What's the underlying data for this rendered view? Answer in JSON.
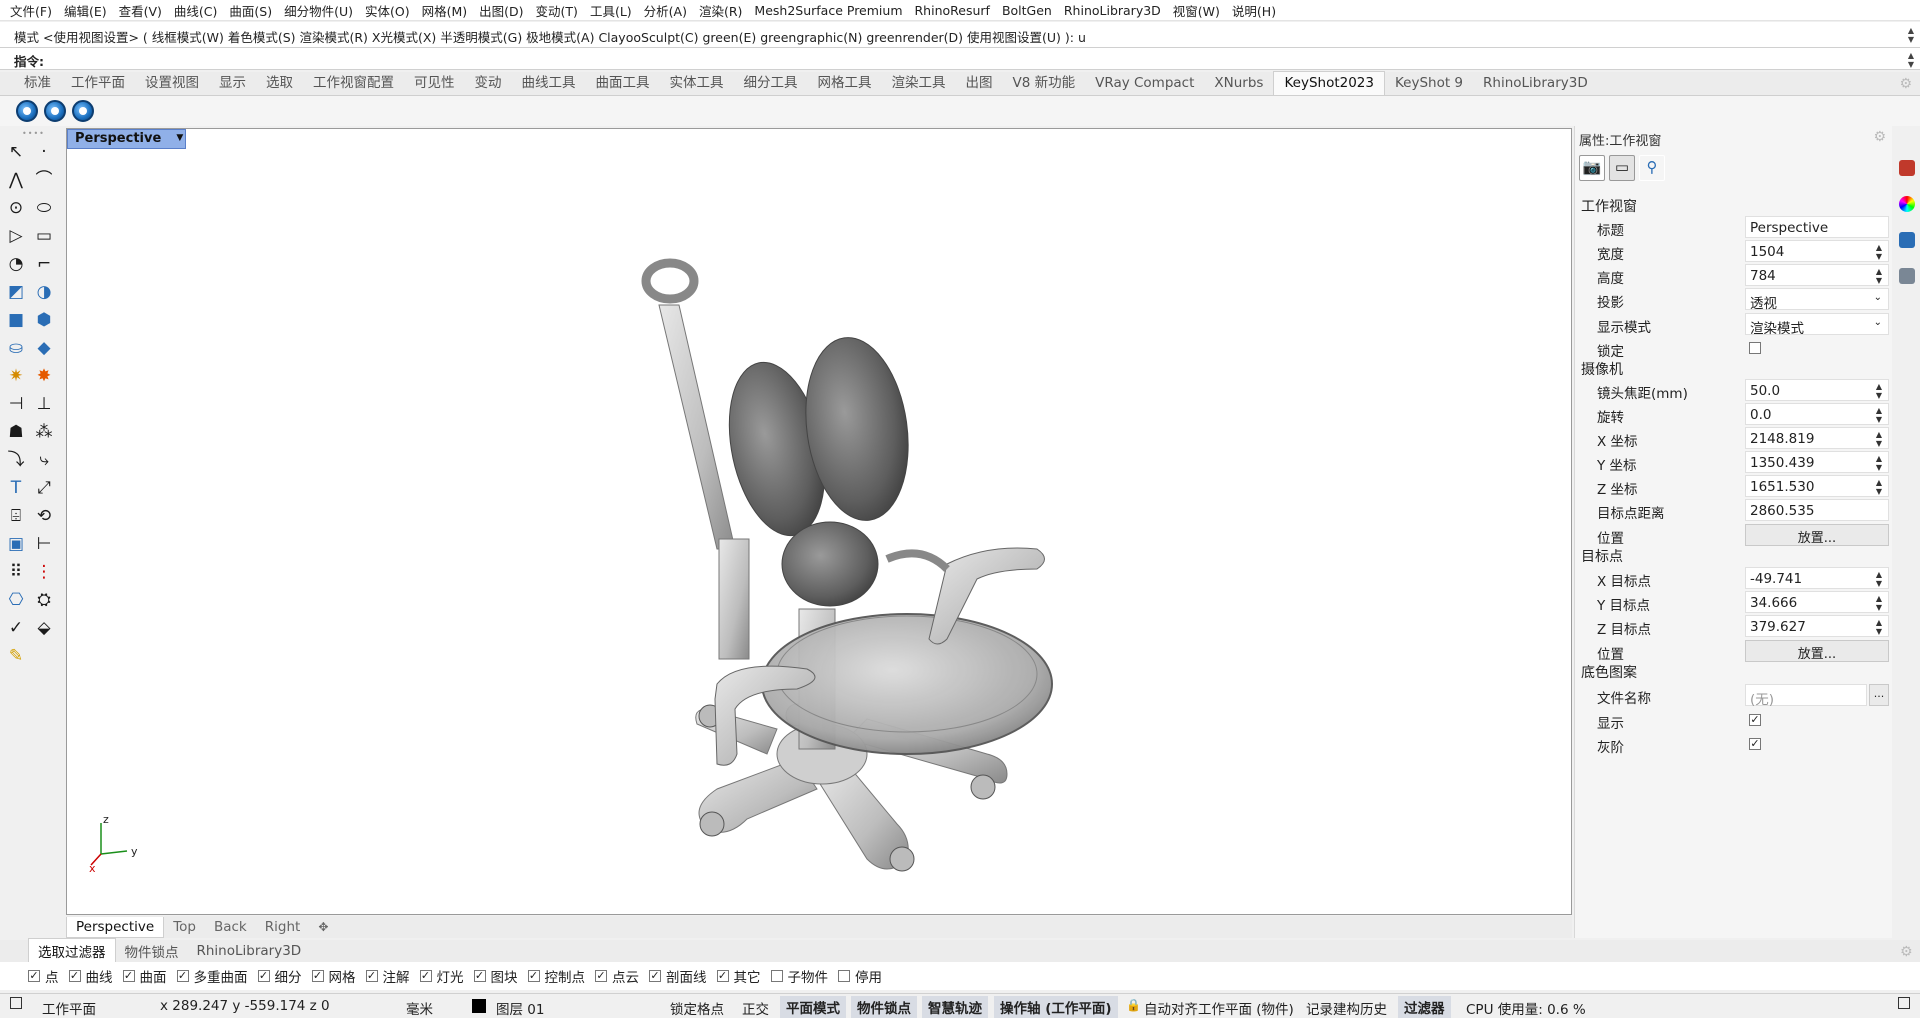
{
  "menu": [
    "文件(F)",
    "编辑(E)",
    "查看(V)",
    "曲线(C)",
    "曲面(S)",
    "细分物件(U)",
    "实体(O)",
    "网格(M)",
    "出图(D)",
    "变动(T)",
    "工具(L)",
    "分析(A)",
    "渲染(R)",
    "Mesh2Surface Premium",
    "RhinoResurf",
    "BoltGen",
    "RhinoLibrary3D",
    "视窗(W)",
    "说明(H)"
  ],
  "command": {
    "history": "模式 <使用视图设置> ( 线框模式(W)  着色模式(S)  渲染模式(R)  X光模式(X)  半透明模式(G)  极地模式(A)  ClayooSculpt(C)  green(E)  greengraphic(N)  greenrender(D)  使用视图设置(U) ): u",
    "prompt": "指令:"
  },
  "toolbar_tabs": [
    "标准",
    "工作平面",
    "设置视图",
    "显示",
    "选取",
    "工作视窗配置",
    "可见性",
    "变动",
    "曲线工具",
    "曲面工具",
    "实体工具",
    "细分工具",
    "网格工具",
    "渲染工具",
    "出图",
    "V8 新功能",
    "VRay Compact",
    "XNurbs",
    "KeyShot2023",
    "KeyShot 9",
    "RhinoLibrary3D"
  ],
  "active_toolbar_tab": "KeyShot2023",
  "viewport": {
    "title": "Perspective",
    "axes": {
      "z": "z",
      "x": "x",
      "y": "y"
    }
  },
  "viewport_tabs": [
    "Perspective",
    "Top",
    "Back",
    "Right"
  ],
  "viewport_add_icon": "✥",
  "properties": {
    "panel_title": "属性:工作视窗",
    "section_viewport": "工作视窗",
    "title_label": "标题",
    "title_value": "Perspective",
    "width_label": "宽度",
    "width_value": "1504",
    "height_label": "高度",
    "height_value": "784",
    "projection_label": "投影",
    "projection_value": "透视",
    "display_mode_label": "显示模式",
    "display_mode_value": "渲染模式",
    "lock_label": "锁定",
    "section_camera": "摄像机",
    "focal_label": "镜头焦距(mm)",
    "focal_value": "50.0",
    "rotation_label": "旋转",
    "rotation_value": "0.0",
    "cam_x_label": "X 坐标",
    "cam_x_value": "2148.819",
    "cam_y_label": "Y 坐标",
    "cam_y_value": "1350.439",
    "cam_z_label": "Z 坐标",
    "cam_z_value": "1651.530",
    "target_dist_label": "目标点距离",
    "target_dist_value": "2860.535",
    "cam_pos_label": "位置",
    "cam_pos_button": "放置...",
    "section_target": "目标点",
    "tgt_x_label": "X 目标点",
    "tgt_x_value": "-49.741",
    "tgt_y_label": "Y 目标点",
    "tgt_y_value": "34.666",
    "tgt_z_label": "Z 目标点",
    "tgt_z_value": "379.627",
    "tgt_pos_label": "位置",
    "tgt_pos_button": "放置...",
    "section_background": "底色图案",
    "filename_label": "文件名称",
    "filename_value": "(无)",
    "filename_browse": "...",
    "show_label": "显示",
    "show_checked": true,
    "gray_label": "灰阶",
    "gray_checked": true
  },
  "bottom_tabs": [
    "选取过滤器",
    "物件锁点",
    "RhinoLibrary3D"
  ],
  "filters": [
    {
      "label": "点",
      "checked": true
    },
    {
      "label": "曲线",
      "checked": true
    },
    {
      "label": "曲面",
      "checked": true
    },
    {
      "label": "多重曲面",
      "checked": true
    },
    {
      "label": "细分",
      "checked": true
    },
    {
      "label": "网格",
      "checked": true
    },
    {
      "label": "注解",
      "checked": true
    },
    {
      "label": "灯光",
      "checked": true
    },
    {
      "label": "图块",
      "checked": true
    },
    {
      "label": "控制点",
      "checked": true
    },
    {
      "label": "点云",
      "checked": true
    },
    {
      "label": "剖面线",
      "checked": true
    },
    {
      "label": "其它",
      "checked": true
    },
    {
      "label": "子物件",
      "checked": false
    },
    {
      "label": "停用",
      "checked": false
    }
  ],
  "side_label": "显示",
  "status": {
    "plane": "工作平面",
    "coords": "x 289.247  y -559.174  z 0",
    "units": "毫米",
    "layer": "图层 01",
    "grid_snap": "锁定格点",
    "ortho": "正交",
    "planar": "平面模式",
    "osnap": "物件锁点",
    "smarttrack": "智慧轨迹",
    "gumball": "操作轴 (工作平面)",
    "autoalign": "自动对齐工作平面 (物件)",
    "history": "记录建构历史",
    "filter": "过滤器",
    "cpu": "CPU 使用量: 0.6 %"
  },
  "colors": {
    "viewport_title_bg": "#90b0e8",
    "keyshot_blue": "#1a6fbf"
  }
}
